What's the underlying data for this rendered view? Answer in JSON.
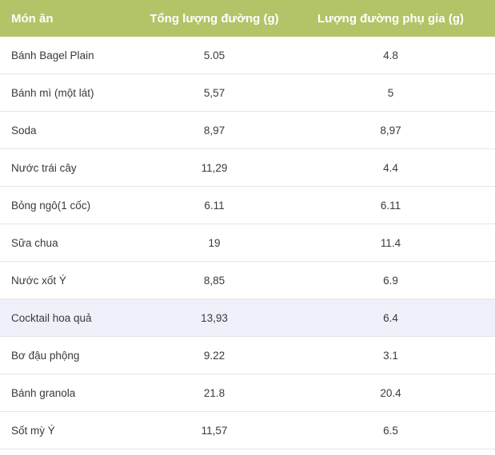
{
  "table": {
    "headers": {
      "food": "Món ăn",
      "total_sugar": "Tổng lượng đường (g)",
      "added_sugar": "Lượng đường phụ gia (g)"
    },
    "rows": [
      {
        "food": "Bánh Bagel Plain",
        "total_sugar": "5.05",
        "added_sugar": "4.8",
        "highlight": false
      },
      {
        "food": "Bánh mì (một lát)",
        "total_sugar": "5,57",
        "added_sugar": "5",
        "highlight": false
      },
      {
        "food": "Soda",
        "total_sugar": "8,97",
        "added_sugar": "8,97",
        "highlight": false
      },
      {
        "food": "Nước trái cây",
        "total_sugar": "11,29",
        "added_sugar": "4.4",
        "highlight": false
      },
      {
        "food": "Bỏng ngô(1 cốc)",
        "total_sugar": "6.11",
        "added_sugar": "6.11",
        "highlight": false
      },
      {
        "food": "Sữa chua",
        "total_sugar": "19",
        "added_sugar": "11.4",
        "highlight": false
      },
      {
        "food": "Nước xốt Ý",
        "total_sugar": "8,85",
        "added_sugar": "6.9",
        "highlight": false
      },
      {
        "food": "Cocktail hoa quả",
        "total_sugar": "13,93",
        "added_sugar": "6.4",
        "highlight": true
      },
      {
        "food": "Bơ đậu phộng",
        "total_sugar": "9.22",
        "added_sugar": "3.1",
        "highlight": false
      },
      {
        "food": "Bánh granola",
        "total_sugar": "21.8",
        "added_sugar": "20.4",
        "highlight": false
      },
      {
        "food": "Sốt mỳ Ý",
        "total_sugar": "11,57",
        "added_sugar": "6.5",
        "highlight": false
      }
    ]
  },
  "colors": {
    "header_bg": "#b3c468",
    "header_text": "#ffffff",
    "row_highlight": "#eef1fa",
    "row_border": "#e6e6e6",
    "body_text": "#3a3a3a"
  }
}
